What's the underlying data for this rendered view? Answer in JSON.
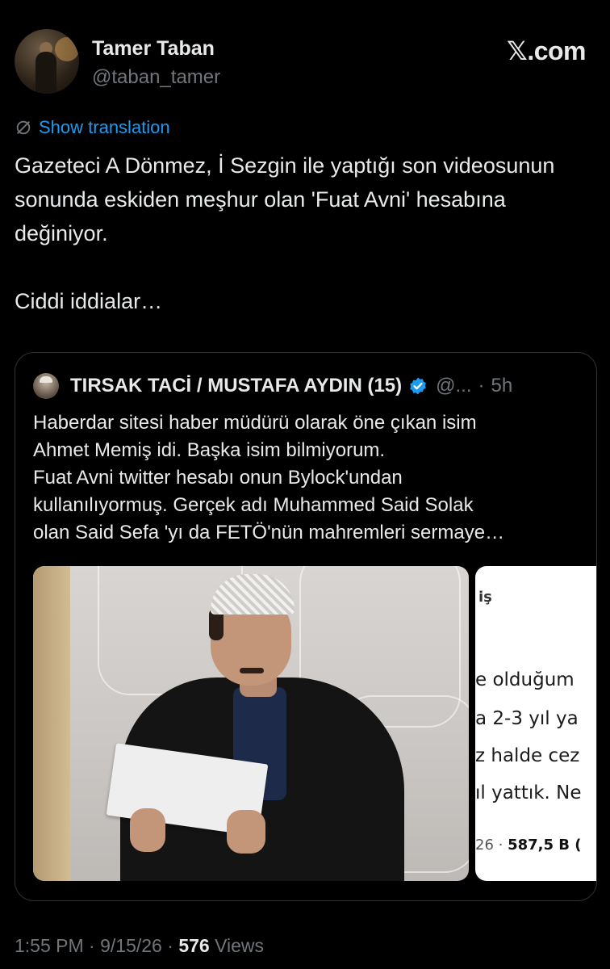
{
  "author": {
    "display_name": "Tamer Taban",
    "handle": "@taban_tamer"
  },
  "brand": {
    "label": "𝕏.com"
  },
  "translation": {
    "label": "Show translation",
    "icon": "globe-slash-icon"
  },
  "tweet": {
    "text": "Gazeteci A Dönmez, İ Sezgin ile yaptığı son videosunun sonunda eskiden meşhur olan 'Fuat Avni' hesabına değiniyor.\n\nCiddi iddialar…"
  },
  "quoted": {
    "display_name": "TIRSAK TACİ / MUSTAFA AYDIN (15)",
    "handle": "@...",
    "separator": "·",
    "time": "5h",
    "verified_color": "#1d9bf0",
    "text": "Haberdar sitesi haber müdürü olarak öne çıkan isim\nAhmet Memiş idi. Başka isim bilmiyorum.\nFuat Avni twitter hesabı onun Bylock'undan\nkullanılıyormuş. Gerçek adı Muhammed Said Solak\nolan Said Sefa 'yı da FETÖ'nün mahremleri sermaye…",
    "media_2": {
      "top": "iş",
      "lines": [
        "e olduğum",
        "a 2-3 yıl ya",
        "z halde cez",
        "ıl yattık. Ne"
      ],
      "meta_prefix": "26 · ",
      "meta_bold": "587,5 B ("
    }
  },
  "footer": {
    "time": "1:55 PM",
    "date": "9/15/26",
    "separator": " · ",
    "views_count": "576",
    "views_label": " Views"
  },
  "colors": {
    "background": "#000000",
    "text": "#e7e9ea",
    "secondary": "#71767b",
    "accent": "#1d9bf0",
    "border": "#2f3336"
  }
}
